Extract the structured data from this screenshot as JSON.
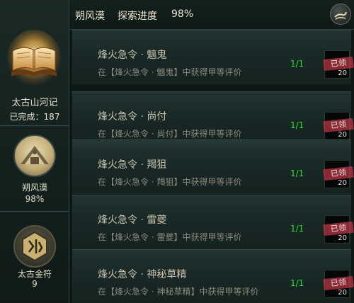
{
  "collection": {
    "title": "太古山河记",
    "completed_label": "已完成：",
    "completed_count": "187"
  },
  "nav": [
    {
      "label": "朔风漠",
      "value": "98%",
      "icon": "tent-icon"
    },
    {
      "label": "太古金符",
      "value": "9",
      "icon": "rune-seal-icon"
    }
  ],
  "header": {
    "region": "朔风漠",
    "progress_label": "探索进度",
    "progress_value": "98%",
    "button_icon": "quill-icon"
  },
  "tasks": [
    {
      "title": "烽火急令 · 魑鬼",
      "description": "在【烽火急令 · 魑鬼】中获得甲等评价",
      "progress": "1/1",
      "stamp": "已领",
      "reward_qty": "20"
    },
    {
      "title": "烽火急令 · 尚付",
      "description": "在【烽火急令 · 尚付】中获得甲等评价",
      "progress": "1/1",
      "stamp": "已领",
      "reward_qty": "20"
    },
    {
      "title": "烽火急令 · 羯狙",
      "description": "在【烽火急令 · 羯狙】中获得甲等评价",
      "progress": "1/1",
      "stamp": "已领",
      "reward_qty": "20"
    },
    {
      "title": "烽火急令 · 雷夔",
      "description": "在【烽火急令 · 雷夔】中获得甲等评价",
      "progress": "1/1",
      "stamp": "已领",
      "reward_qty": "20"
    },
    {
      "title": "烽火急令 · 神秘草精",
      "description": "在【烽火急令 · 神秘草精】中获得甲等评价",
      "progress": "1/1",
      "stamp": "已领",
      "reward_qty": "20"
    }
  ],
  "colors": {
    "progress_complete": "#33dd33",
    "claimed_stamp": "#be3746"
  }
}
